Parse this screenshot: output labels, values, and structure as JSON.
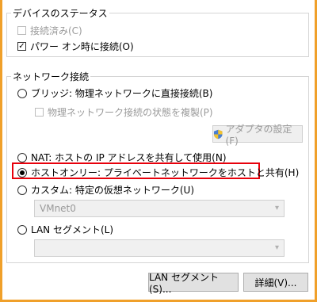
{
  "device_status": {
    "title": "デバイスのステータス",
    "connected": {
      "label": "接続済み(C)",
      "checked": false,
      "enabled": false
    },
    "connect_power_on": {
      "label": "パワー オン時に接続(O)",
      "checked": true,
      "enabled": true
    }
  },
  "network": {
    "title": "ネットワーク接続",
    "bridged": {
      "label": "ブリッジ: 物理ネットワークに直接接続(B)",
      "selected": false
    },
    "replicate": {
      "label": "物理ネットワーク接続の状態を複製(P)",
      "checked": false,
      "enabled": false
    },
    "adapter_button": "アダプタの設定(F)",
    "nat": {
      "label": "NAT: ホストの IP アドレスを共有して使用(N)",
      "selected": false
    },
    "host_only": {
      "label": "ホストオンリー: プライベートネットワークをホストと共有(H)",
      "selected": true
    },
    "custom": {
      "label": "カスタム: 特定の仮想ネットワーク(U)",
      "selected": false
    },
    "custom_select": {
      "value": "VMnet0"
    },
    "lan_segment": {
      "label": "LAN セグメント(L)",
      "selected": false
    },
    "lan_select": {
      "value": ""
    }
  },
  "buttons": {
    "lan_segments": "LAN セグメント(S)...",
    "advanced": "詳細(V)..."
  },
  "colors": {
    "highlight": "#e8000b",
    "window_border": "#f0a02a"
  }
}
